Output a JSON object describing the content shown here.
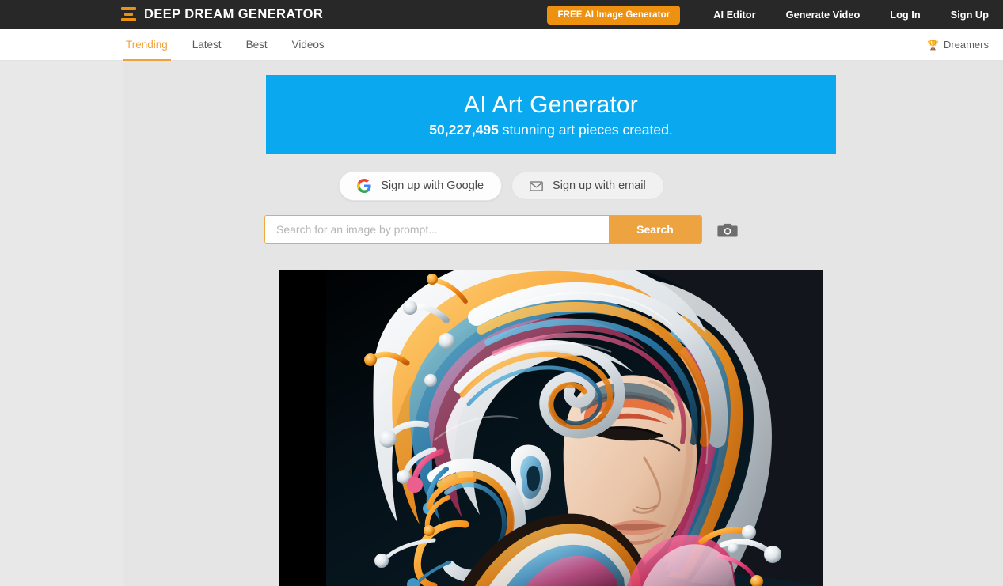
{
  "header": {
    "brand": "DEEP DREAM GENERATOR",
    "brand_icon": "hourglass-logo-icon",
    "cta_label": "FREE AI Image Generator",
    "nav": [
      {
        "label": "AI Editor"
      },
      {
        "label": "Generate Video"
      },
      {
        "label": "Log In"
      },
      {
        "label": "Sign Up"
      }
    ],
    "accent_color": "#ef9110",
    "background_color": "#292828"
  },
  "subnav": {
    "tabs": [
      {
        "label": "Trending",
        "active": true
      },
      {
        "label": "Latest",
        "active": false
      },
      {
        "label": "Best",
        "active": false
      },
      {
        "label": "Videos",
        "active": false
      }
    ],
    "dreamers": {
      "label": "Dreamers",
      "icon": "trophy-icon"
    },
    "active_color": "#f0a23c"
  },
  "hero": {
    "title": "AI Art Generator",
    "count": "50,227,495",
    "subtitle_rest": " stunning art pieces created.",
    "background_color": "#0aa8ef"
  },
  "signup": {
    "google_label": "Sign up with Google",
    "google_icon": "google-g-icon",
    "email_label": "Sign up with email",
    "email_icon": "envelope-icon"
  },
  "search": {
    "placeholder": "Search for an image by prompt...",
    "value": "",
    "button_label": "Search",
    "camera_icon": "camera-icon",
    "accent_color": "#eda340"
  },
  "artwork": {
    "alt": "AI generated portrait of a woman with flowing multicolored swirling hair",
    "background_color": "#000000"
  }
}
